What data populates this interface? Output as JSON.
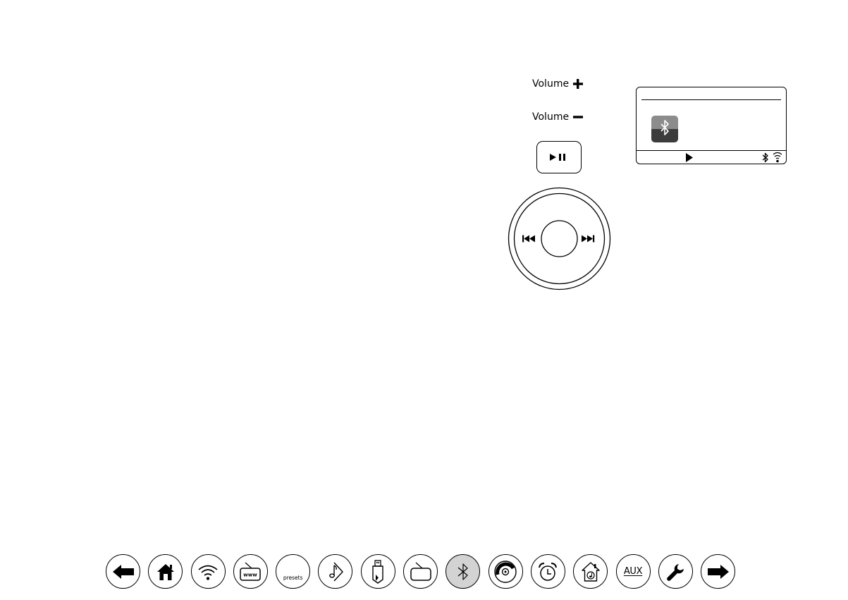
{
  "volume": {
    "up_label": "Volume",
    "down_label": "Volume"
  },
  "nav": {
    "items": [
      {
        "icon": "back-arrow-icon"
      },
      {
        "icon": "home-icon"
      },
      {
        "icon": "wifi-icon"
      },
      {
        "icon": "internet-radio-icon",
        "text": "www"
      },
      {
        "icon": "presets-icon",
        "text": "presets"
      },
      {
        "icon": "music-player-icon"
      },
      {
        "icon": "usb-icon"
      },
      {
        "icon": "radio-icon"
      },
      {
        "icon": "bluetooth-icon",
        "active": true
      },
      {
        "icon": "cd-icon"
      },
      {
        "icon": "alarm-clock-icon"
      },
      {
        "icon": "upnp-home-icon"
      },
      {
        "icon": "aux-icon",
        "text": "AUX"
      },
      {
        "icon": "wrench-icon"
      },
      {
        "icon": "forward-arrow-icon"
      }
    ]
  },
  "colors": {
    "active_nav_bg": "#d3d3d3",
    "bt_tile_top": "#8c8c8c",
    "bt_tile_bottom": "#3c3c3c"
  }
}
